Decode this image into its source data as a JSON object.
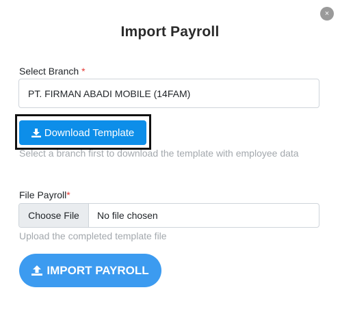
{
  "modal": {
    "title": "Import Payroll",
    "close_glyph": "×"
  },
  "branch": {
    "label": "Select Branch",
    "required_mark": "*",
    "selected_value": "PT. FIRMAN ABADI MOBILE (14FAM)",
    "download_label": "Download Template",
    "download_icon": "download-icon",
    "help_text": "Select a branch first to download the template with employee data"
  },
  "file": {
    "label": "File Payroll",
    "required_mark": "*",
    "choose_label": "Choose File",
    "current_value": "No file chosen",
    "help_text": "Upload the completed template file"
  },
  "import": {
    "label": "IMPORT PAYROLL",
    "icon": "upload-icon"
  },
  "colors": {
    "primary": "#0d8ee9",
    "import_button": "#3c9bf0",
    "required": "#e53935",
    "help_text": "#a3a8ad"
  }
}
